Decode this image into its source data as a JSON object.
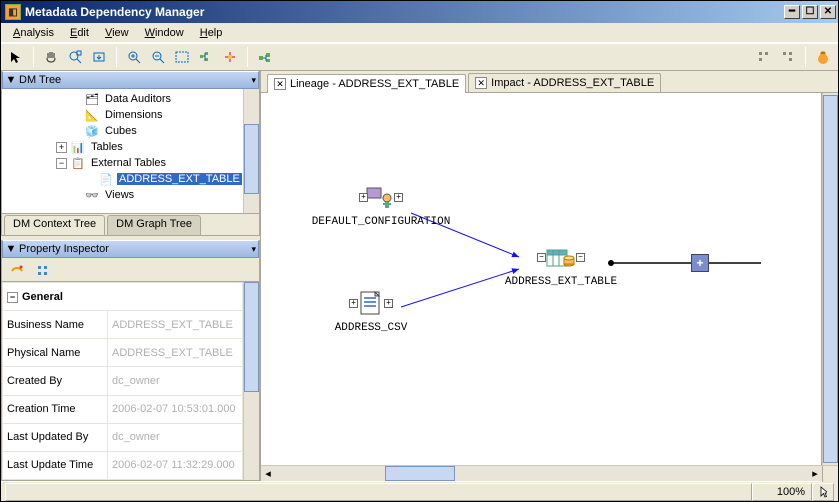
{
  "window": {
    "title": "Metadata Dependency Manager"
  },
  "menu": {
    "analysis": "Analysis",
    "edit": "Edit",
    "view": "View",
    "window": "Window",
    "help": "Help"
  },
  "tree_panel": {
    "title": "DM Tree",
    "tabs": {
      "context": "DM Context Tree",
      "graph": "DM Graph Tree"
    },
    "items": {
      "data_auditors": "Data Auditors",
      "dimensions": "Dimensions",
      "cubes": "Cubes",
      "tables": "Tables",
      "external_tables": "External Tables",
      "address_ext_table": "ADDRESS_EXT_TABLE",
      "views": "Views"
    }
  },
  "property_panel": {
    "title": "Property Inspector",
    "category": "General",
    "rows": {
      "business_name": {
        "label": "Business Name",
        "value": "ADDRESS_EXT_TABLE"
      },
      "physical_name": {
        "label": "Physical Name",
        "value": "ADDRESS_EXT_TABLE"
      },
      "created_by": {
        "label": "Created By",
        "value": "dc_owner"
      },
      "creation_time": {
        "label": "Creation Time",
        "value": "2006-02-07 10:53:01.000"
      },
      "last_updated_by": {
        "label": "Last Updated By",
        "value": "dc_owner"
      },
      "last_update_time": {
        "label": "Last Update Time",
        "value": "2006-02-07 11:32:29.000"
      }
    }
  },
  "canvas": {
    "tabs": {
      "lineage": "Lineage - ADDRESS_EXT_TABLE",
      "impact": "Impact - ADDRESS_EXT_TABLE"
    },
    "nodes": {
      "default_config": "DEFAULT_CONFIGURATION",
      "address_csv": "ADDRESS_CSV",
      "address_ext_table": "ADDRESS_EXT_TABLE"
    }
  },
  "status": {
    "zoom": "100%"
  }
}
